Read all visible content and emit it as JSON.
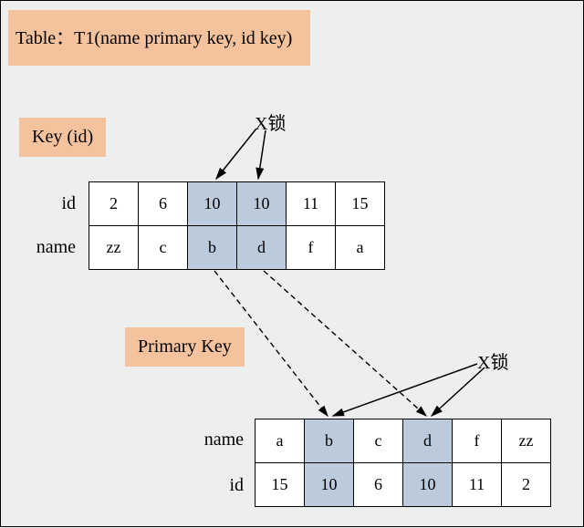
{
  "title": "Table：T1(name primary key, id key)",
  "key_label": "Key (id)",
  "primary_label": "Primary Key",
  "xlock1": "X锁",
  "xlock2": "X锁",
  "row_id": "id",
  "row_name": "name",
  "tableA": {
    "r1": {
      "c0": "2",
      "c1": "6",
      "c2": "10",
      "c3": "10",
      "c4": "11",
      "c5": "15"
    },
    "r2": {
      "c0": "zz",
      "c1": "c",
      "c2": "b",
      "c3": "d",
      "c4": "f",
      "c5": "a"
    }
  },
  "tableB": {
    "r1": {
      "c0": "a",
      "c1": "b",
      "c2": "c",
      "c3": "d",
      "c4": "f",
      "c5": "zz"
    },
    "r2": {
      "c0": "15",
      "c1": "10",
      "c2": "6",
      "c3": "10",
      "c4": "11",
      "c5": "2"
    }
  },
  "colors": {
    "highlight": "#bccbdc",
    "box": "#f4c29c",
    "bg": "#edeeee"
  }
}
